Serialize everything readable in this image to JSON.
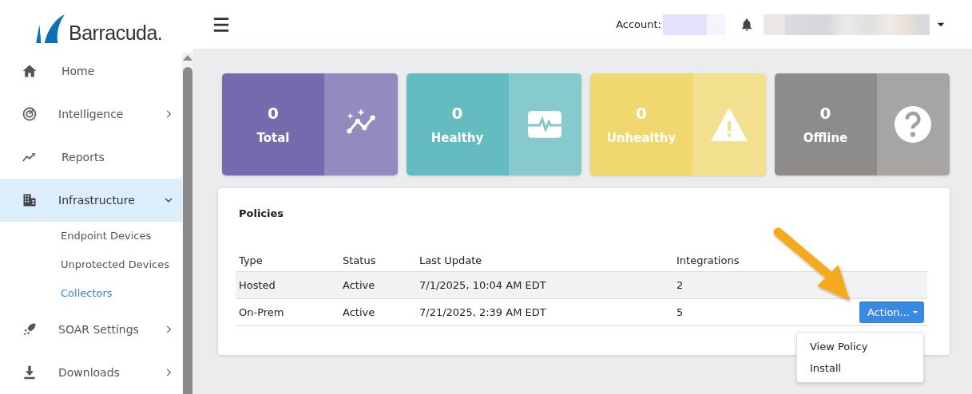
{
  "logo": {
    "text": "Barracuda."
  },
  "sidebar": {
    "items": [
      {
        "label": "Home",
        "kind": "link",
        "selected": false
      },
      {
        "label": "Intelligence",
        "kind": "group",
        "expanded": false,
        "selected": false
      },
      {
        "label": "Reports",
        "kind": "link",
        "selected": false
      },
      {
        "label": "Infrastructure",
        "kind": "group",
        "expanded": true,
        "selected": true,
        "children": [
          {
            "label": "Endpoint Devices",
            "selected": false
          },
          {
            "label": "Unprotected Devices",
            "selected": false
          },
          {
            "label": "Collectors",
            "selected": true
          }
        ]
      },
      {
        "label": "SOAR Settings",
        "kind": "group",
        "expanded": false,
        "selected": false
      },
      {
        "label": "Downloads",
        "kind": "group",
        "expanded": false,
        "selected": false
      }
    ]
  },
  "header": {
    "account_label": "Account:"
  },
  "stat_cards": [
    {
      "value": "0",
      "label": "Total",
      "color": "#736bae"
    },
    {
      "value": "0",
      "label": "Healthy",
      "color": "#64bbc0"
    },
    {
      "value": "0",
      "label": "Unhealthy",
      "color": "#f0d86f"
    },
    {
      "value": "0",
      "label": "Offline",
      "color": "#8e8c8b"
    }
  ],
  "policies": {
    "title": "Policies",
    "columns": [
      "Type",
      "Status",
      "Last Update",
      "Integrations"
    ],
    "rows": [
      {
        "cells": [
          "Hosted",
          "Active",
          "7/1/2025, 10:04 AM EDT",
          "2"
        ],
        "highlighted": true
      },
      {
        "cells": [
          "On-Prem",
          "Active",
          "7/21/2025, 2:39 AM EDT",
          "5"
        ],
        "highlighted": false,
        "action": {
          "label": "Action...",
          "expanded": true,
          "menu": [
            "View Policy",
            "Install"
          ]
        }
      }
    ]
  }
}
